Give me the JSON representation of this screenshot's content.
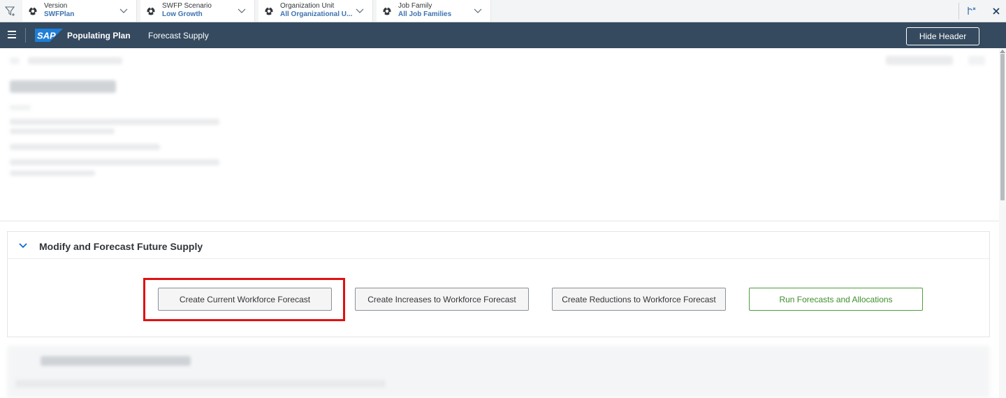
{
  "filter_bar": {
    "filters": [
      {
        "label": "Version",
        "value": "SWFPlan"
      },
      {
        "label": "SWFP Scenario",
        "value": "Low Growth"
      },
      {
        "label": "Organization Unit",
        "value": "All Organizational U..."
      },
      {
        "label": "Job Family",
        "value": "All Job Families"
      }
    ],
    "icons": {
      "filter": "filter-add-icon",
      "settings": "variant-settings-icon",
      "close": "close-icon"
    }
  },
  "shell": {
    "logo": "SAP",
    "app_title": "Populating Plan",
    "page_title": "Forecast Supply",
    "hide_header_label": "Hide Header"
  },
  "section": {
    "title": "Modify and Forecast Future Supply",
    "buttons": [
      {
        "label": "Create Current Workforce Forecast"
      },
      {
        "label": "Create Increases to Workforce Forecast"
      },
      {
        "label": "Create Reductions to Workforce Forecast"
      },
      {
        "label": "Run Forecasts and Allocations"
      }
    ]
  },
  "colors": {
    "shell_bg": "#354a5f",
    "filter_value": "#3e73b0",
    "highlight": "#e01111",
    "run_button": "#3f8f2c"
  }
}
